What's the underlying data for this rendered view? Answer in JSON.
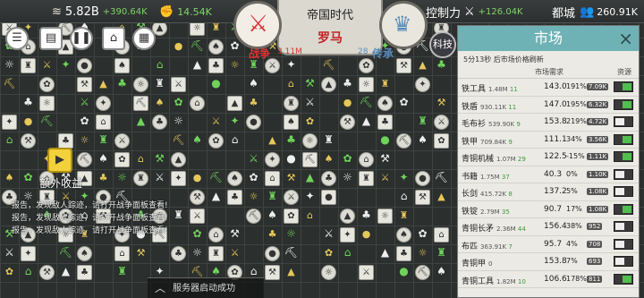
{
  "top": {
    "money": "5.82B",
    "money_rate": "+390.64K",
    "power": "14.54K",
    "control_label": "控制力",
    "control_rate": "+126.04K",
    "city_label": "都城",
    "population": "260.91K"
  },
  "emblem": {
    "era": "帝国时代",
    "civ": "罗马",
    "war_label": "战争",
    "war_value": "3.11M",
    "heritage_label": "传承",
    "heritage_value": "28"
  },
  "tech_label": "科技",
  "extra_income_label": "额外收益",
  "reports": [
    "报告，发现敌人踪迹，请打开战争面板查看!",
    "报告，发现敌人踪迹，请打开战争面板查看!",
    "报告，发现敌人踪迹，请打开战争面板查看!"
  ],
  "server_status": "服务器启动成功",
  "market": {
    "title": "市场",
    "close": "×",
    "refresh": "5分13秒 后市场价格刷新",
    "col_demand": "市场需求",
    "col_resource": "资源",
    "rows": [
      {
        "name": "铁工具",
        "qty": "1.48M",
        "qty2": "11",
        "price": "143.0",
        "pct": "191%",
        "stock": "7.09K",
        "on": true
      },
      {
        "name": "铁盾",
        "qty": "930.11K",
        "qty2": "11",
        "price": "147.0",
        "pct": "195%",
        "stock": "6.32K",
        "on": true
      },
      {
        "name": "毛布衫",
        "qty": "539.90K",
        "qty2": "9",
        "price": "153.8",
        "pct": "219%",
        "stock": "4.72K",
        "on": false
      },
      {
        "name": "铁甲",
        "qty": "709.84K",
        "qty2": "9",
        "price": "111.1",
        "pct": "34%",
        "stock": "3.56K",
        "on": true
      },
      {
        "name": "青铜机械",
        "qty": "1.07M",
        "qty2": "29",
        "price": "122.5",
        "pct": "-15%",
        "stock": "1.11K",
        "on": true
      },
      {
        "name": "书籍",
        "qty": "1.75M",
        "qty2": "37",
        "price": "40.3",
        "pct": "0%",
        "stock": "1.10K",
        "on": false
      },
      {
        "name": "长剑",
        "qty": "415.72K",
        "qty2": "8",
        "price": "137.2",
        "pct": "5%",
        "stock": "1.08K",
        "on": false
      },
      {
        "name": "铁锭",
        "qty": "2.79M",
        "qty2": "35",
        "price": "90.7",
        "pct": "17%",
        "stock": "1.08K",
        "on": true
      },
      {
        "name": "青铜长矛",
        "qty": "2.36M",
        "qty2": "44",
        "price": "156.4",
        "pct": "38%",
        "stock": "952",
        "on": false
      },
      {
        "name": "布匹",
        "qty": "363.91K",
        "qty2": "7",
        "price": "95.7",
        "pct": "4%",
        "stock": "708",
        "on": false
      },
      {
        "name": "青铜甲",
        "qty": "0",
        "qty2": "",
        "price": "153.8",
        "pct": "7%",
        "stock": "693",
        "on": false
      },
      {
        "name": "青铜工具",
        "qty": "1.82M",
        "qty2": "10",
        "price": "106.6",
        "pct": "178%",
        "stock": "811",
        "on": true
      }
    ]
  }
}
